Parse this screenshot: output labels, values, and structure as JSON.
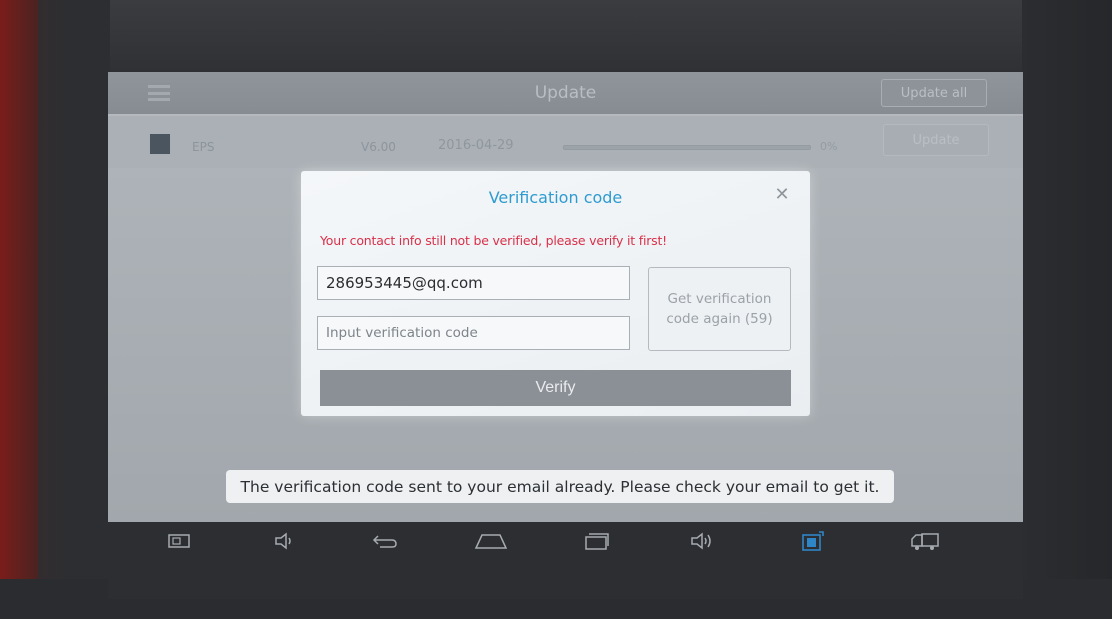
{
  "app": {
    "title": "Update",
    "update_all_label": "Update all"
  },
  "update_list": {
    "items": [
      {
        "name": "EPS",
        "version": "V6.00",
        "date": "2016-04-29",
        "progress_percent": 0,
        "percent_label": "0%",
        "update_label": "Update"
      }
    ]
  },
  "dialog": {
    "title": "Verification code",
    "close_glyph": "✕",
    "warning": "Your contact info still not be verified, please verify it first!",
    "email_value": "286953445@qq.com",
    "code_placeholder": "Input verification code",
    "resend_label": "Get verification code again (59)",
    "verify_label": "Verify"
  },
  "toast": {
    "message": "The verification code sent to your email already. Please check your email to get it."
  },
  "nav_bar": {
    "icons": [
      "screenshot-icon",
      "volume-down-icon",
      "back-icon",
      "home-icon",
      "recent-apps-icon",
      "volume-up-icon",
      "vci-icon",
      "truck-icon"
    ]
  },
  "colors": {
    "dialog_title": "#2e9bd0",
    "warning": "#d9304a",
    "verify_button": "#8a9095",
    "nav_highlight": "#2f86c6"
  }
}
